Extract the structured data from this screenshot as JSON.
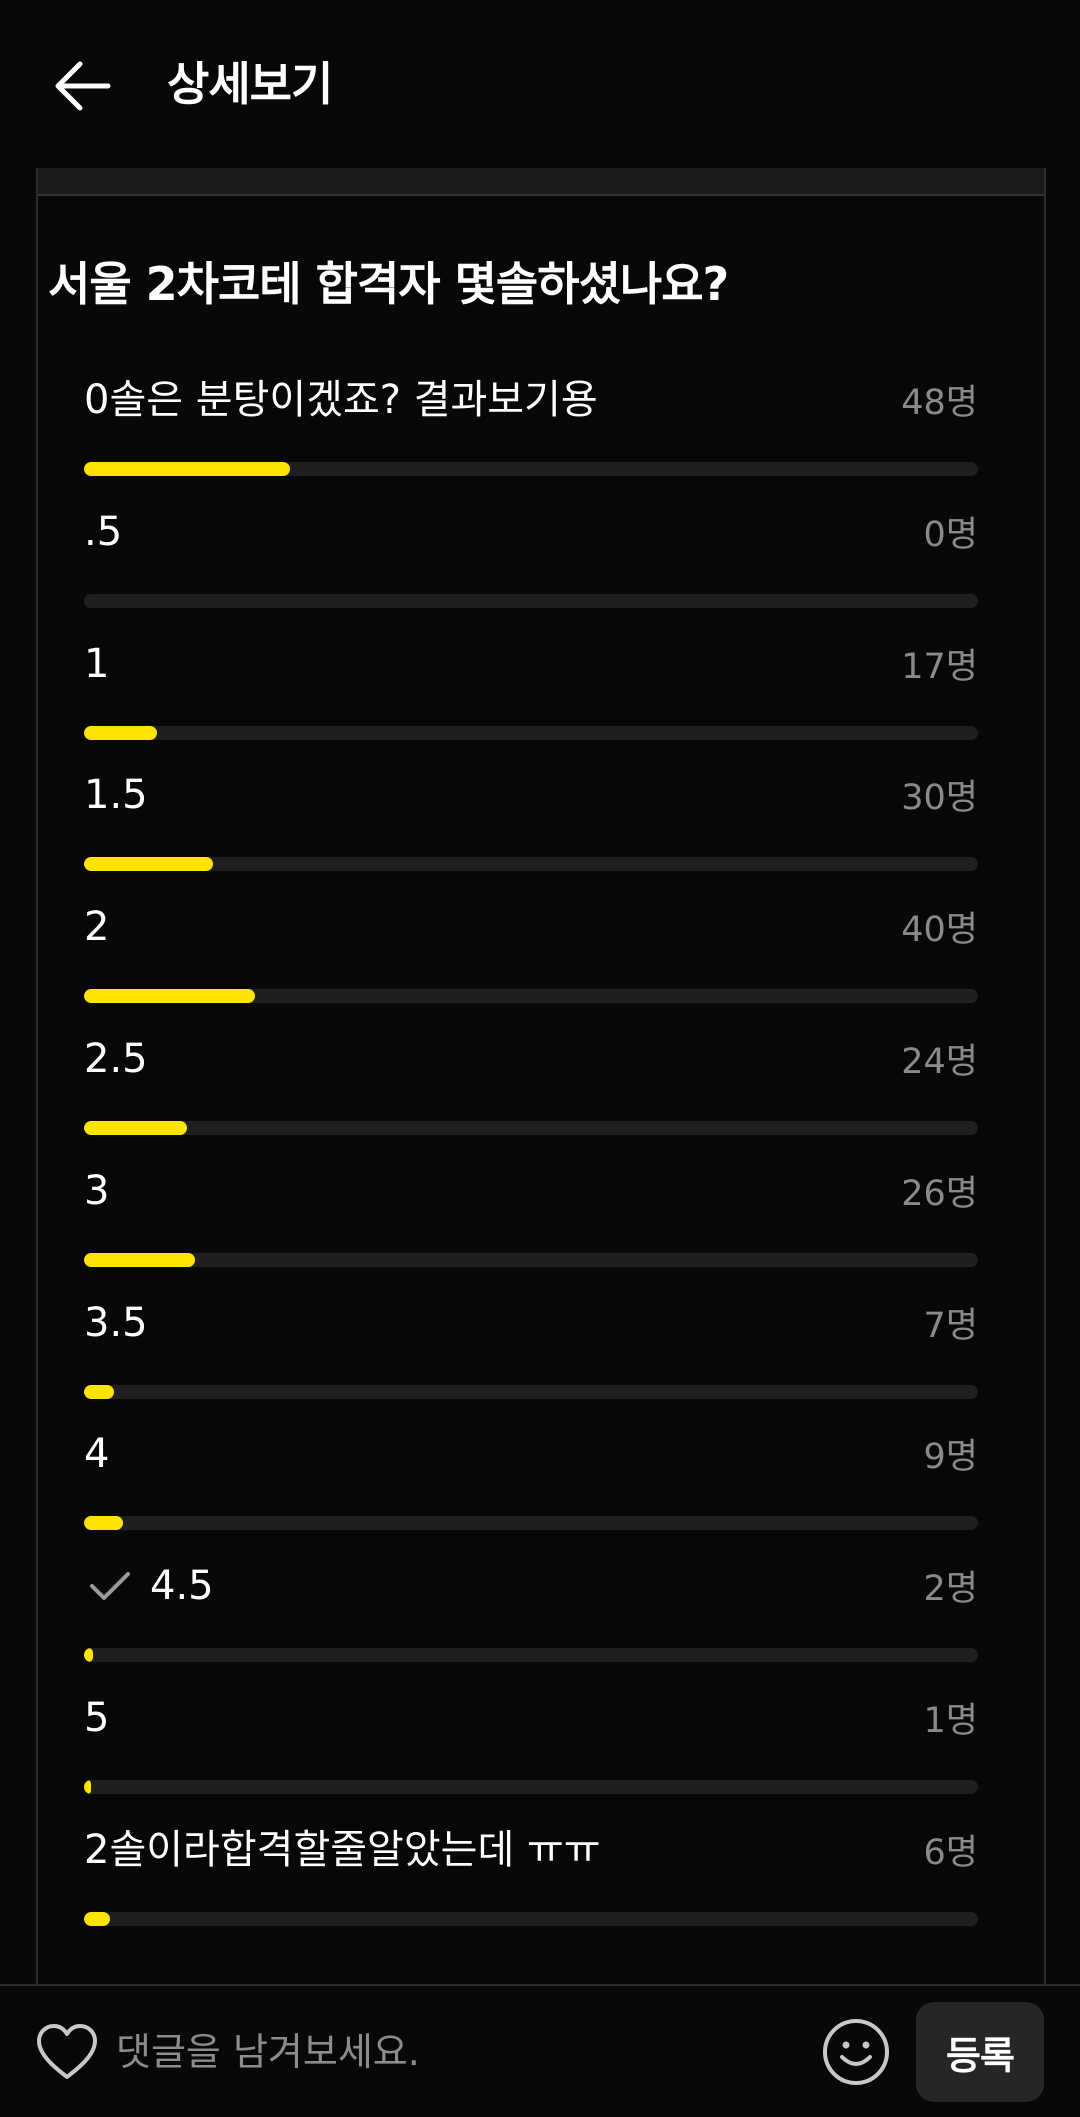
{
  "header": {
    "back_icon": "arrow-left-icon",
    "title": "상세보기"
  },
  "poll": {
    "question": "서울 2차코테 합격자 몇솔하셨나요?",
    "max_votes": 48,
    "options": [
      {
        "label": "0솔은 분탕이겠죠? 결과보기용",
        "count_text": "48명",
        "votes": 48,
        "checked": false
      },
      {
        "label": ".5",
        "count_text": "0명",
        "votes": 0,
        "checked": false
      },
      {
        "label": "1",
        "count_text": "17명",
        "votes": 17,
        "checked": false
      },
      {
        "label": "1.5",
        "count_text": "30명",
        "votes": 30,
        "checked": false
      },
      {
        "label": "2",
        "count_text": "40명",
        "votes": 40,
        "checked": false
      },
      {
        "label": "2.5",
        "count_text": "24명",
        "votes": 24,
        "checked": false
      },
      {
        "label": "3",
        "count_text": "26명",
        "votes": 26,
        "checked": false
      },
      {
        "label": "3.5",
        "count_text": "7명",
        "votes": 7,
        "checked": false
      },
      {
        "label": "4",
        "count_text": "9명",
        "votes": 9,
        "checked": false
      },
      {
        "label": "4.5",
        "count_text": "2명",
        "votes": 2,
        "checked": true
      },
      {
        "label": "5",
        "count_text": "1명",
        "votes": 1,
        "checked": false
      },
      {
        "label": "2솔이라합격할줄알았는데 ㅠㅠ",
        "count_text": "6명",
        "votes": 6,
        "checked": false
      }
    ]
  },
  "comment_bar": {
    "like_icon": "heart-outline-icon",
    "placeholder": "댓글을 남겨보세요.",
    "emoji_icon": "smiley-icon",
    "submit_label": "등록"
  },
  "colors": {
    "background": "#080808",
    "accent": "#ffe400",
    "track": "#1f1f1f",
    "muted_text": "#8a8a8a"
  }
}
